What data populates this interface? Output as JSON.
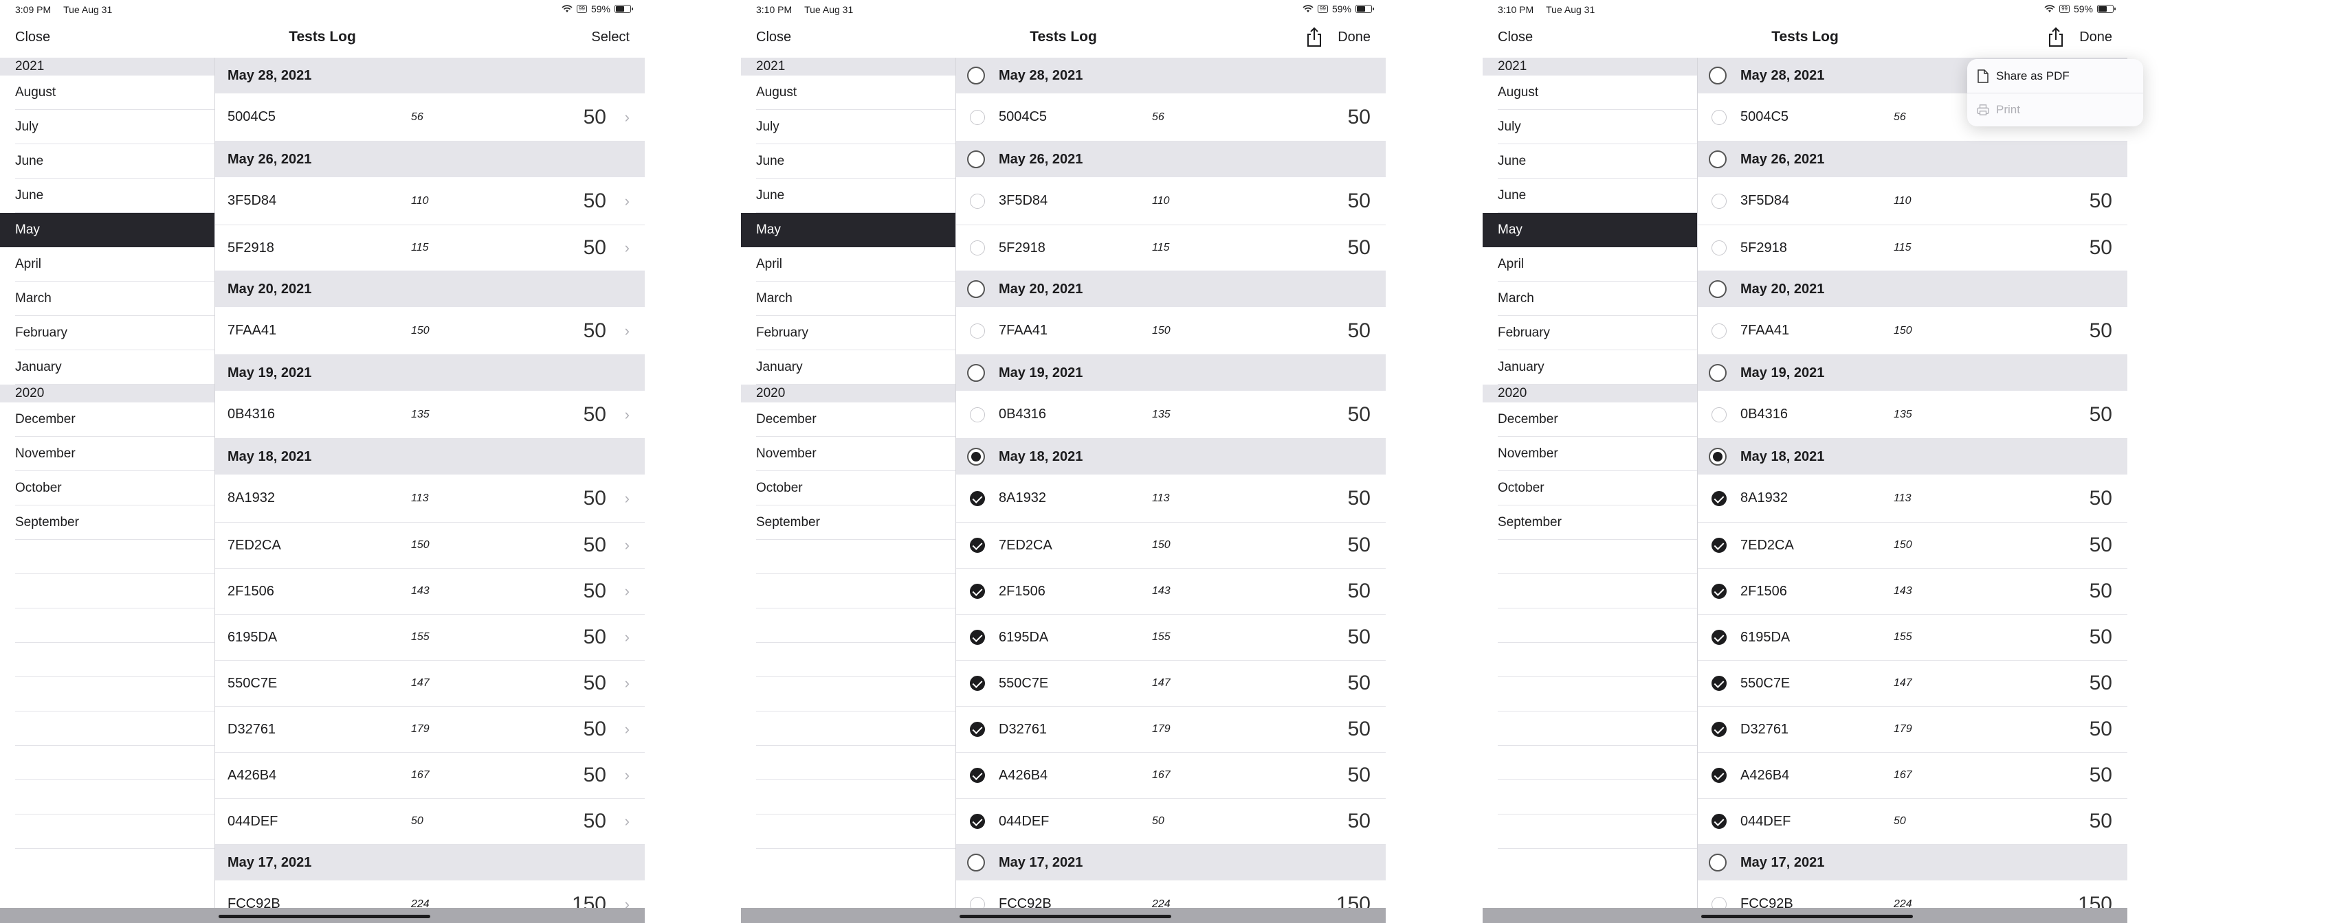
{
  "panels": [
    {
      "status": {
        "time": "3:09 PM",
        "date": "Tue Aug 31",
        "battery": "59%",
        "battery_icon_text": "99"
      },
      "nav": {
        "left": "Close",
        "title": "Tests Log",
        "right": "Select",
        "share_icon": null
      }
    },
    {
      "status": {
        "time": "3:10 PM",
        "date": "Tue Aug 31",
        "battery": "59%",
        "battery_icon_text": "99"
      },
      "nav": {
        "left": "Close",
        "title": "Tests Log",
        "right": "Done",
        "share_icon": "share-icon"
      }
    },
    {
      "status": {
        "time": "3:10 PM",
        "date": "Tue Aug 31",
        "battery": "59%",
        "battery_icon_text": "99"
      },
      "nav": {
        "left": "Close",
        "title": "Tests Log",
        "right": "Done",
        "share_icon": "share-icon"
      }
    }
  ],
  "sidebar": {
    "years": [
      {
        "year": "2021",
        "months": [
          "August",
          "July",
          "June",
          "June",
          "May",
          "April",
          "March",
          "February",
          "January"
        ]
      },
      {
        "year": "2020",
        "months": [
          "December",
          "November",
          "October",
          "September"
        ]
      }
    ],
    "selected_month": "May"
  },
  "sections": [
    {
      "date": "May 28, 2021",
      "rows": [
        {
          "id": "5004C5",
          "count": "56",
          "value": "50"
        }
      ]
    },
    {
      "date": "May 26, 2021",
      "rows": [
        {
          "id": "3F5D84",
          "count": "110",
          "value": "50"
        },
        {
          "id": "5F2918",
          "count": "115",
          "value": "50"
        }
      ]
    },
    {
      "date": "May 20, 2021",
      "rows": [
        {
          "id": "7FAA41",
          "count": "150",
          "value": "50"
        }
      ]
    },
    {
      "date": "May 19, 2021",
      "rows": [
        {
          "id": "0B4316",
          "count": "135",
          "value": "50"
        }
      ]
    },
    {
      "date": "May 18, 2021",
      "rows": [
        {
          "id": "8A1932",
          "count": "113",
          "value": "50"
        },
        {
          "id": "7ED2CA",
          "count": "150",
          "value": "50"
        },
        {
          "id": "2F1506",
          "count": "143",
          "value": "50"
        },
        {
          "id": "6195DA",
          "count": "155",
          "value": "50"
        },
        {
          "id": "550C7E",
          "count": "147",
          "value": "50"
        },
        {
          "id": "D32761",
          "count": "179",
          "value": "50"
        },
        {
          "id": "A426B4",
          "count": "167",
          "value": "50"
        },
        {
          "id": "044DEF",
          "count": "50",
          "value": "50"
        }
      ]
    },
    {
      "date": "May 17, 2021",
      "rows": [
        {
          "id": "FCC92B",
          "count": "224",
          "value": "150"
        }
      ]
    }
  ],
  "selection": {
    "selected_section": "May 18, 2021"
  },
  "share_menu": {
    "items": [
      {
        "label": "Share as PDF",
        "icon": "document-icon",
        "enabled": true
      },
      {
        "label": "Print",
        "icon": "printer-icon",
        "enabled": false
      }
    ]
  },
  "colors": {
    "selected_bg": "#26262c",
    "section_bg": "#e5e5ea"
  }
}
